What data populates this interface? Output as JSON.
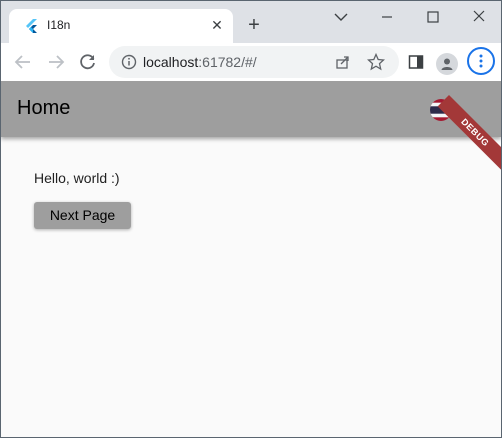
{
  "browser": {
    "tab": {
      "title": "I18n",
      "favicon": "flutter-icon"
    },
    "new_tab_icon": "plus-icon",
    "window_controls": [
      "chevron-down-icon",
      "minimize-icon",
      "maximize-icon",
      "close-icon"
    ],
    "address_bar": {
      "host": "localhost",
      "rest": ":61782/#/",
      "info_icon": "info-icon"
    },
    "toolbar_icons": [
      "back-icon",
      "forward-icon",
      "reload-icon",
      "share-icon",
      "star-icon",
      "side-panel-icon",
      "profile-icon",
      "more-icon"
    ]
  },
  "app": {
    "appbar": {
      "title": "Home",
      "flag": "thai-flag-icon",
      "color": "#9e9e9e"
    },
    "debug_banner": "DEBUG",
    "body": {
      "greeting": "Hello, world :)",
      "button_label": "Next Page"
    }
  }
}
